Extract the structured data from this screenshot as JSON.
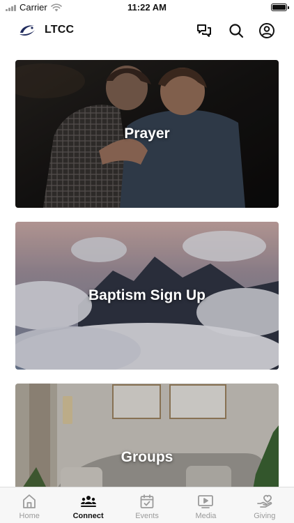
{
  "status_bar": {
    "carrier": "Carrier",
    "time": "11:22 AM",
    "battery_level": 1.0
  },
  "header": {
    "app_name": "LTCC",
    "logo_icon": "ltcc-swoosh-logo",
    "icons": [
      "chat-icon",
      "search-icon",
      "account-icon"
    ]
  },
  "cards": [
    {
      "title": "Prayer"
    },
    {
      "title": "Baptism Sign Up"
    },
    {
      "title": "Groups"
    }
  ],
  "tabs": [
    {
      "label": "Home",
      "icon": "home-icon",
      "active": false
    },
    {
      "label": "Connect",
      "icon": "people-group-icon",
      "active": true
    },
    {
      "label": "Events",
      "icon": "calendar-check-icon",
      "active": false
    },
    {
      "label": "Media",
      "icon": "play-screen-icon",
      "active": false
    },
    {
      "label": "Giving",
      "icon": "hand-heart-icon",
      "active": false
    }
  ],
  "colors": {
    "active_tab": "#111111",
    "inactive_tab": "#9a9a9a",
    "logo_accent": "#1f2a5c"
  }
}
